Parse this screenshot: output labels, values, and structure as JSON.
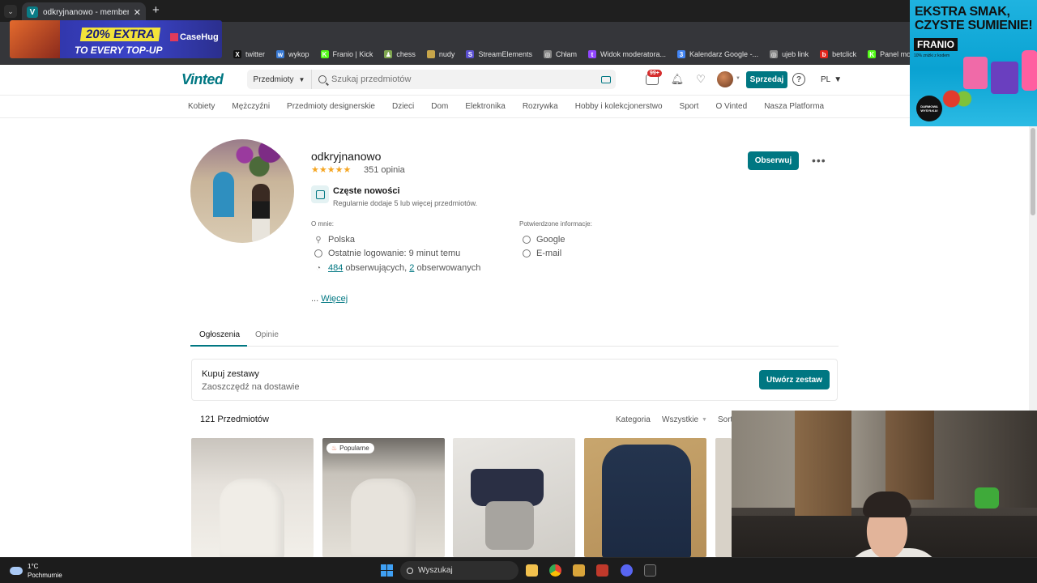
{
  "browser": {
    "tab_title": "odkryjnanowo - member profile",
    "tab_favicon": "V",
    "new_tab": "+",
    "tab_close": "✕",
    "bookmarks": [
      {
        "label": "twitter",
        "icon": "x-icon",
        "color": "#111111",
        "glyph": "X"
      },
      {
        "label": "wykop",
        "icon": "wykop-icon",
        "color": "#3a7bd5",
        "glyph": "w"
      },
      {
        "label": "Franio | Kick",
        "icon": "kick-icon",
        "color": "#53fc18",
        "glyph": "K"
      },
      {
        "label": "chess",
        "icon": "chess-icon",
        "color": "#7fa650",
        "glyph": "♟"
      },
      {
        "label": "nudy",
        "icon": "folder-icon",
        "color": "#c8a64a",
        "glyph": ""
      },
      {
        "label": "StreamElements",
        "icon": "streamelements-icon",
        "color": "#5a4fcf",
        "glyph": "S"
      },
      {
        "label": "Chłam",
        "icon": "globe-icon",
        "color": "#888888",
        "glyph": "◎"
      },
      {
        "label": "Widok moderatora...",
        "icon": "twitch-icon",
        "color": "#9146ff",
        "glyph": "t"
      },
      {
        "label": "Kalendarz Google -...",
        "icon": "calendar-icon",
        "color": "#4285f4",
        "glyph": "3"
      },
      {
        "label": "ujeb link",
        "icon": "globe-icon",
        "color": "#888888",
        "glyph": "◎"
      },
      {
        "label": "betclick",
        "icon": "betclick-icon",
        "color": "#e2231a",
        "glyph": "b"
      },
      {
        "label": "Panel moderatora |...",
        "icon": "kick-icon",
        "color": "#53fc18",
        "glyph": "K"
      }
    ]
  },
  "ad_left": {
    "line1": "20% EXTRA",
    "line2": "TO EVERY TOP-UP",
    "brand": "CaseHug"
  },
  "ad_right": {
    "line1": "EKSTRA SMAK,",
    "line2": "CZYSTE SUMIENIE!",
    "brand": "FRANIO",
    "small": "10% zniżki z kodem",
    "roundel": "DARMOWA WYSYŁKA!"
  },
  "header": {
    "logo": "Vinted",
    "category_select": "Przedmioty",
    "search_placeholder": "Szukaj przedmiotów",
    "inbox_badge": "99+",
    "sell_label": "Sprzedaj",
    "help": "?",
    "lang": "PL"
  },
  "catnav": [
    "Kobiety",
    "Mężczyźni",
    "Przedmioty designerskie",
    "Dzieci",
    "Dom",
    "Elektronika",
    "Rozrywka",
    "Hobby i kolekcjonerstwo",
    "Sport",
    "O Vinted",
    "Nasza Platforma"
  ],
  "profile": {
    "username": "odkryjnanowo",
    "rating": 5,
    "stars": "★★★★★",
    "reviews": "351 opinia",
    "follow_label": "Obserwuj",
    "more": "•••",
    "badge_title": "Częste nowości",
    "badge_sub": "Regularnie dodaje 5 lub więcej przedmiotów.",
    "about_label": "O mnie:",
    "verified_label": "Potwierdzone informacje:",
    "location": "Polska",
    "last_login": "Ostatnie logowanie: 9 minut temu",
    "followers_count": "484",
    "followers_text": " obserwujących, ",
    "following_count": "2",
    "following_text": " obserwowanych",
    "verified": [
      "Google",
      "E-mail"
    ],
    "more_prefix": "... ",
    "more_link": "Więcej"
  },
  "tabs": [
    "Ogłoszenia",
    "Opinie"
  ],
  "bundle": {
    "title": "Kupuj zestawy",
    "subtitle": "Zaoszczędź na dostawie",
    "button": "Utwórz zestaw"
  },
  "items": {
    "count": "121 Przedmiotów",
    "filter_category": "Kategoria",
    "filter_all": "Wszystkie",
    "sort": "Sort",
    "popular_badge": "Popularne"
  },
  "taskbar": {
    "temp": "1°C",
    "weather": "Pochmurnie",
    "search": "Wyszukaj"
  }
}
